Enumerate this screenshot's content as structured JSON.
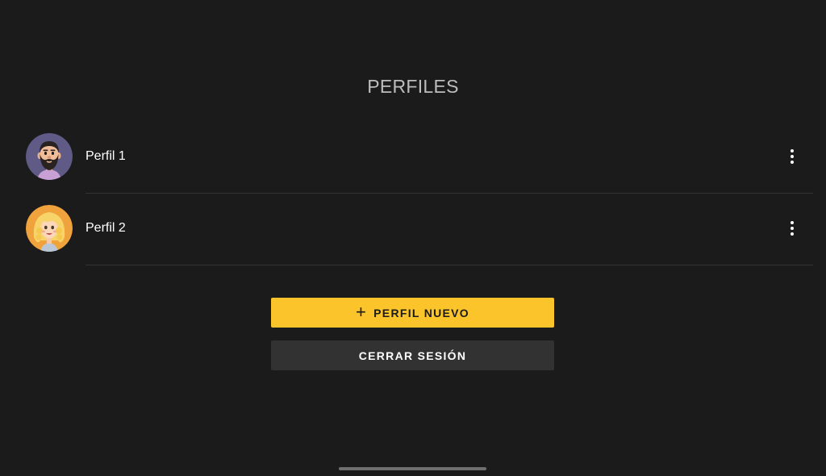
{
  "header": {
    "title": "PERFILES"
  },
  "profiles": [
    {
      "name": "Perfil 1",
      "avatar": "bearded-man-avatar"
    },
    {
      "name": "Perfil 2",
      "avatar": "blonde-woman-avatar"
    }
  ],
  "actions": {
    "new_profile_label": "PERFIL NUEVO",
    "new_profile_icon": "plus-icon",
    "logout_label": "CERRAR SESIÓN"
  },
  "colors": {
    "background": "#1b1b1b",
    "accent": "#fac42a",
    "secondary_button": "#323232",
    "divider": "#333333"
  }
}
